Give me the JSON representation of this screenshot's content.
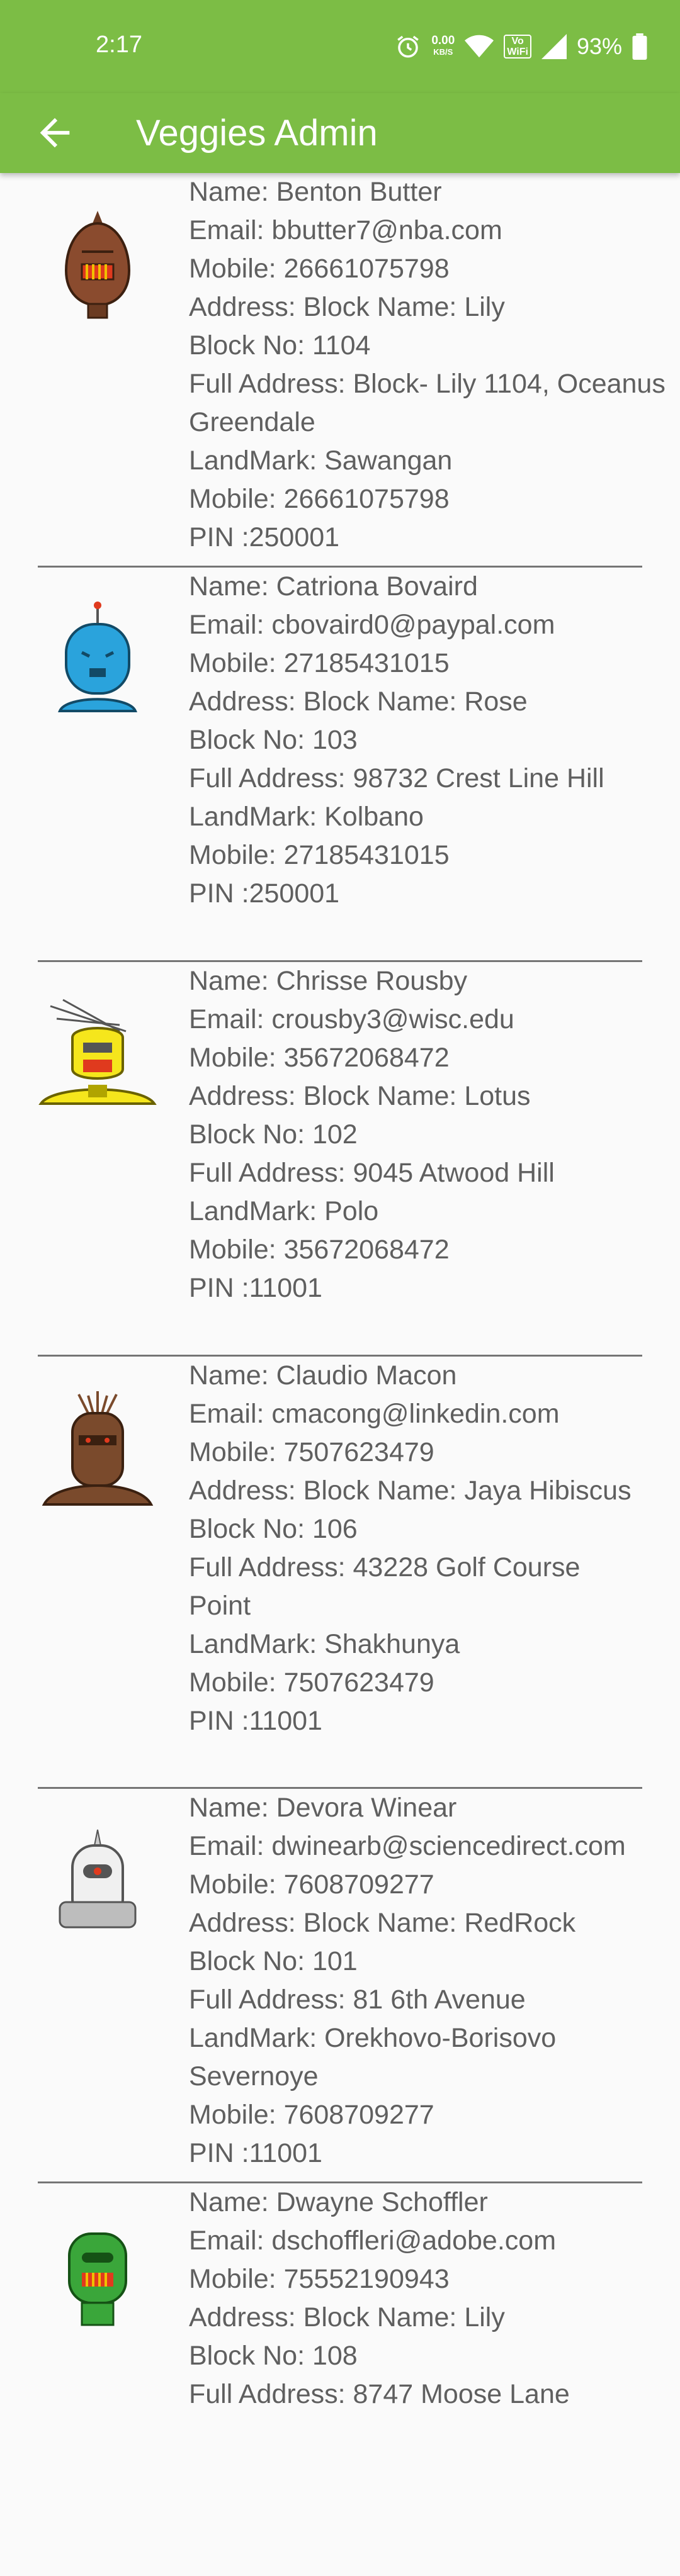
{
  "status_bar": {
    "time": "2:17",
    "net_speed_value": "0.00",
    "net_speed_unit": "KB/S",
    "vowifi_top": "Vo",
    "vowifi_bottom": "WiFi",
    "battery": "93%"
  },
  "app_bar": {
    "title": "Veggies Admin",
    "background_color": "#7cbd45"
  },
  "users": [
    {
      "avatar_color": "#8a4b2e",
      "name": "Name: Benton Butter",
      "email": "Email: bbutter7@nba.com",
      "mobile": "Mobile: 26661075798",
      "block_name": "Address: Block Name: Lily",
      "block_no": "Block No: 1104",
      "full_address": "Full Address: Block- Lily 1104, Oceanus Greendale",
      "landmark": "LandMark: Sawangan",
      "mobile2": "Mobile: 26661075798",
      "pin": "PIN :250001"
    },
    {
      "avatar_color": "#2aa3dc",
      "name": "Name: Catriona Bovaird",
      "email": "Email: cbovaird0@paypal.com",
      "mobile": "Mobile: 27185431015",
      "block_name": "Address: Block Name: Rose",
      "block_no": "Block No: 103",
      "full_address": "Full Address: 98732 Crest Line Hill",
      "landmark": "LandMark: Kolbano",
      "mobile2": "Mobile: 27185431015",
      "pin": "PIN :250001"
    },
    {
      "avatar_color": "#f5e61c",
      "name": "Name: Chrisse Rousby",
      "email": "Email: crousby3@wisc.edu",
      "mobile": "Mobile: 35672068472",
      "block_name": "Address: Block Name: Lotus",
      "block_no": "Block No: 102",
      "full_address": "Full Address: 9045 Atwood Hill",
      "landmark": "LandMark: Polo",
      "mobile2": "Mobile: 35672068472",
      "pin": "PIN :11001"
    },
    {
      "avatar_color": "#7a4a2c",
      "name": "Name: Claudio Macon",
      "email": "Email: cmacong@linkedin.com",
      "mobile": "Mobile: 7507623479",
      "block_name": "Address: Block Name: Jaya Hibiscus",
      "block_no": "Block No: 106",
      "full_address": "Full Address: 43228 Golf Course Point",
      "landmark": "LandMark: Shakhunya",
      "mobile2": "Mobile: 7507623479",
      "pin": "PIN :11001"
    },
    {
      "avatar_color": "#e9e9e9",
      "name": "Name: Devora Winear",
      "email": "Email: dwinearb@sciencedirect.com",
      "mobile": "Mobile: 7608709277",
      "block_name": "Address: Block Name: RedRock",
      "block_no": "Block No: 101",
      "full_address": "Full Address: 81 6th Avenue",
      "landmark": "LandMark: Orekhovo-Borisovo Severnoye",
      "mobile2": "Mobile: 7608709277",
      "pin": "PIN :11001"
    },
    {
      "avatar_color": "#3aa63a",
      "name": "Name: Dwayne Schoffler",
      "email": "Email: dschoffleri@adobe.com",
      "mobile": "Mobile: 75552190943",
      "block_name": "Address: Block Name: Lily",
      "block_no": "Block No: 108",
      "full_address": "Full Address: 8747 Moose Lane"
    }
  ]
}
